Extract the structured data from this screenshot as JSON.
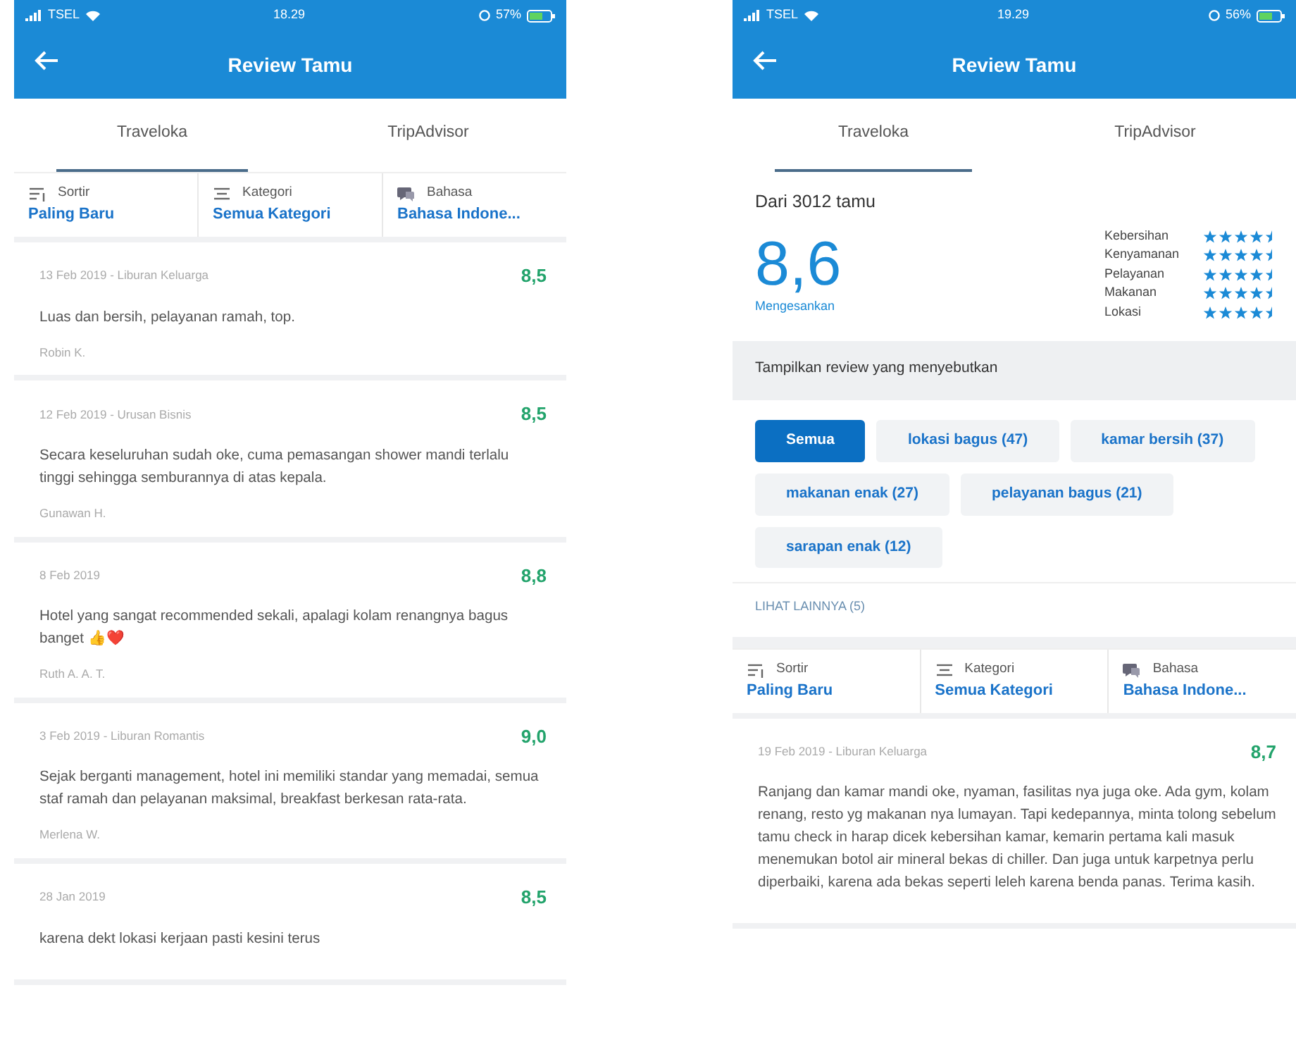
{
  "phones": [
    {
      "status_bar": {
        "carrier": "TSEL",
        "time": "18.29",
        "battery": "57%"
      },
      "header": {
        "title": "Review Tamu"
      },
      "tabs": [
        {
          "label": "Traveloka",
          "selected": true
        },
        {
          "label": "TripAdvisor",
          "selected": false
        }
      ],
      "filters": [
        {
          "kind": "sort",
          "label": "Sortir",
          "value": "Paling Baru"
        },
        {
          "kind": "category",
          "label": "Kategori",
          "value": "Semua Kategori"
        },
        {
          "kind": "language",
          "label": "Bahasa",
          "value": "Bahasa Indone..."
        }
      ],
      "reviews": [
        {
          "meta": "13 Feb 2019 - Liburan Keluarga",
          "score": "8,5",
          "text": "Luas dan bersih, pelayanan ramah, top.",
          "author": "Robin K."
        },
        {
          "meta": "12 Feb 2019 - Urusan Bisnis",
          "score": "8,5",
          "text": "Secara keseluruhan sudah oke, cuma pemasangan shower mandi terlalu tinggi sehingga semburannya di atas kepala.",
          "author": "Gunawan H."
        },
        {
          "meta": "8 Feb 2019",
          "score": "8,8",
          "text": "Hotel yang sangat recommended sekali, apalagi kolam renangnya bagus banget 👍❤️",
          "author": "Ruth A. A. T."
        },
        {
          "meta": "3 Feb 2019 - Liburan Romantis",
          "score": "9,0",
          "text": "Sejak berganti management, hotel ini memiliki standar yang memadai, semua staf ramah dan pelayanan maksimal, breakfast berkesan rata-rata.",
          "author": "Merlena W."
        },
        {
          "meta": "28 Jan 2019",
          "score": "8,5",
          "text": "karena dekt lokasi kerjaan pasti kesini terus"
        }
      ]
    },
    {
      "status_bar": {
        "carrier": "TSEL",
        "time": "19.29",
        "battery": "56%"
      },
      "header": {
        "title": "Review Tamu"
      },
      "tabs": [
        {
          "label": "Traveloka",
          "selected": true
        },
        {
          "label": "TripAdvisor",
          "selected": false
        }
      ],
      "summary": {
        "count": "Dari 3012 tamu",
        "score": "8,6",
        "verdict": "Mengesankan",
        "ratings": [
          {
            "label": "Kebersihan",
            "stars": 4.5
          },
          {
            "label": "Kenyamanan",
            "stars": 4.5
          },
          {
            "label": "Pelayanan",
            "stars": 4.5
          },
          {
            "label": "Makanan",
            "stars": 4.5
          },
          {
            "label": "Lokasi",
            "stars": 4.5
          }
        ]
      },
      "mentions": {
        "heading": "Tampilkan review yang menyebutkan",
        "chips": [
          {
            "label": "Semua",
            "selected": true
          },
          {
            "label": "lokasi bagus (47)",
            "selected": false
          },
          {
            "label": "kamar bersih (37)",
            "selected": false
          },
          {
            "label": "makanan enak (27)",
            "selected": false
          },
          {
            "label": "pelayanan bagus (21)",
            "selected": false
          },
          {
            "label": "sarapan enak (12)",
            "selected": false
          }
        ],
        "more": "LIHAT LAINNYA (5)"
      },
      "filters": [
        {
          "kind": "sort",
          "label": "Sortir",
          "value": "Paling Baru"
        },
        {
          "kind": "category",
          "label": "Kategori",
          "value": "Semua Kategori"
        },
        {
          "kind": "language",
          "label": "Bahasa",
          "value": "Bahasa Indone..."
        }
      ],
      "reviews": [
        {
          "meta": "19 Feb 2019 - Liburan Keluarga",
          "score": "8,7",
          "text": "Ranjang dan kamar mandi oke, nyaman, fasilitas nya juga oke. Ada gym, kolam renang, resto yg makanan nya lumayan. Tapi kedepannya, minta tolong sebelum tamu check in harap dicek kebersihan kamar, kemarin pertama kali masuk menemukan botol air mineral bekas di chiller. Dan juga untuk karpetnya perlu diperbaiki, karena ada bekas seperti leleh karena benda panas. Terima kasih."
        }
      ]
    }
  ]
}
